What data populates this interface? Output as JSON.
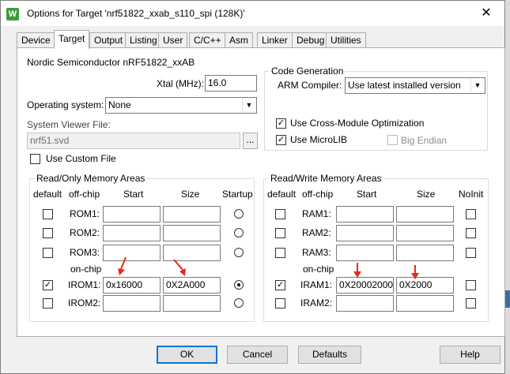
{
  "window": {
    "title": "Options for Target 'nrf51822_xxab_s110_spi (128K)'"
  },
  "tabs": [
    {
      "label": "Device"
    },
    {
      "label": "Target"
    },
    {
      "label": "Output"
    },
    {
      "label": "Listing"
    },
    {
      "label": "User"
    },
    {
      "label": "C/C++"
    },
    {
      "label": "Asm"
    },
    {
      "label": "Linker"
    },
    {
      "label": "Debug"
    },
    {
      "label": "Utilities"
    }
  ],
  "target": {
    "device_name": "Nordic Semiconductor nRF51822_xxAB",
    "xtal_label": "Xtal (MHz):",
    "xtal_value": "16.0",
    "os_label": "Operating system:",
    "os_value": "None",
    "sysviewer_label": "System Viewer File:",
    "sysviewer_value": "nrf51.svd",
    "browse_label": "...",
    "custom_file_label": "Use Custom File"
  },
  "codegen": {
    "title": "Code Generation",
    "compiler_label": "ARM Compiler:",
    "compiler_value": "Use latest installed version",
    "cross_module_label": "Use Cross-Module Optimization",
    "microlib_label": "Use MicroLIB",
    "big_endian_label": "Big Endian"
  },
  "ro_memory": {
    "title": "Read/Only Memory Areas",
    "headers": {
      "default": "default",
      "offchip": "off-chip",
      "start": "Start",
      "size": "Size",
      "last": "Startup"
    },
    "onchip_label": "on-chip",
    "rows": [
      {
        "name": "ROM1:",
        "start": "",
        "size": ""
      },
      {
        "name": "ROM2:",
        "start": "",
        "size": ""
      },
      {
        "name": "ROM3:",
        "start": "",
        "size": ""
      },
      {
        "name": "IROM1:",
        "start": "0x16000",
        "size": "0X2A000"
      },
      {
        "name": "IROM2:",
        "start": "",
        "size": ""
      }
    ]
  },
  "rw_memory": {
    "title": "Read/Write Memory Areas",
    "headers": {
      "default": "default",
      "offchip": "off-chip",
      "start": "Start",
      "size": "Size",
      "last": "NoInit"
    },
    "onchip_label": "on-chip",
    "rows": [
      {
        "name": "RAM1:",
        "start": "",
        "size": ""
      },
      {
        "name": "RAM2:",
        "start": "",
        "size": ""
      },
      {
        "name": "RAM3:",
        "start": "",
        "size": ""
      },
      {
        "name": "IRAM1:",
        "start": "0X20002000",
        "size": "0X2000"
      },
      {
        "name": "IRAM2:",
        "start": "",
        "size": ""
      }
    ]
  },
  "buttons": {
    "ok": "OK",
    "cancel": "Cancel",
    "defaults": "Defaults",
    "help": "Help"
  },
  "colors": {
    "annotation_arrow": "#e8291c",
    "accent": "#0078d7"
  }
}
